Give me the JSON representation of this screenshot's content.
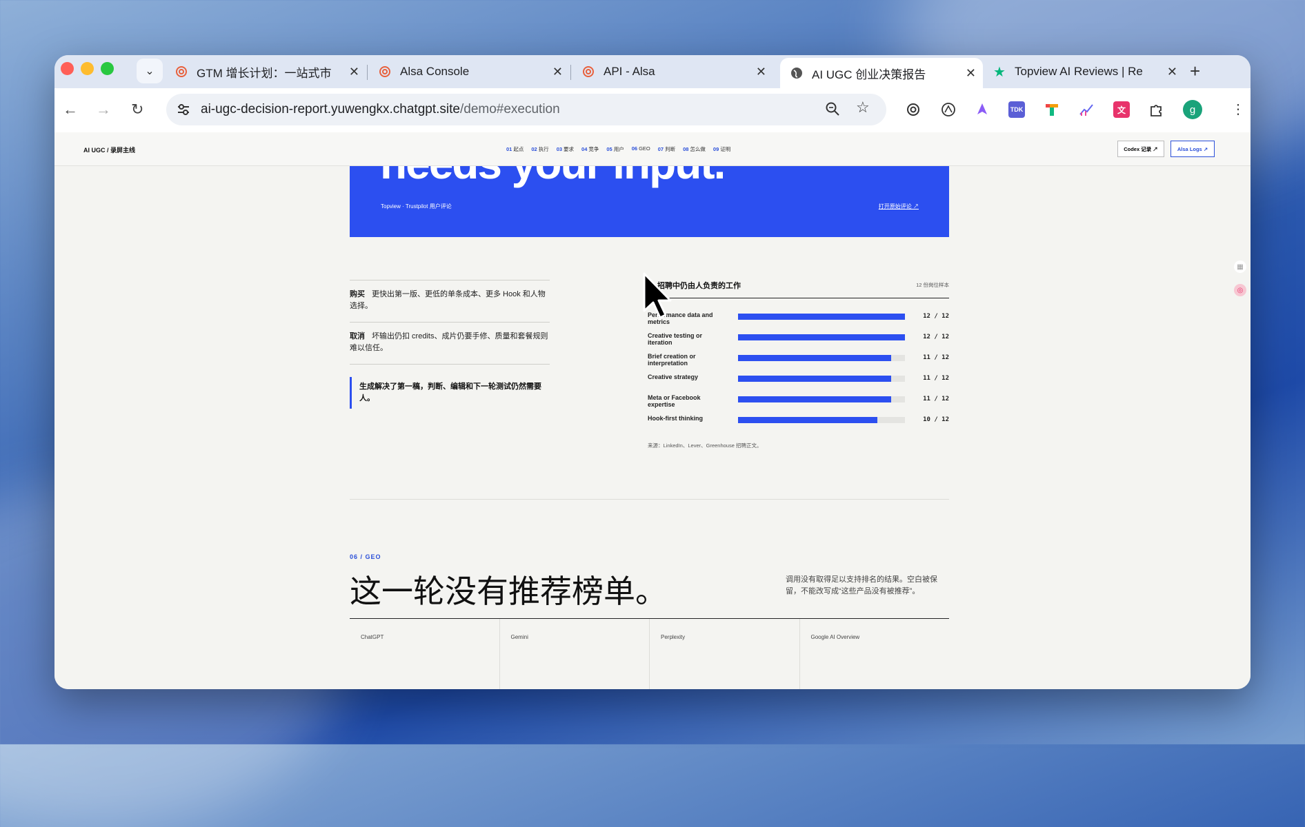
{
  "browser": {
    "tabs": [
      {
        "label": "GTM 增长计划：一站式市",
        "icon": "openai-icon",
        "active": false
      },
      {
        "label": "Alsa Console",
        "icon": "openai-icon",
        "active": false
      },
      {
        "label": "API - Alsa",
        "icon": "openai-icon",
        "active": false
      },
      {
        "label": "AI UGC 创业决策报告",
        "icon": "globe-icon",
        "active": true
      },
      {
        "label": "Topview AI Reviews | Re",
        "icon": "trustpilot-star-icon",
        "active": false
      }
    ],
    "url_host": "ai-ugc-decision-report.yuwengkx.chatgpt.site",
    "url_path": "/demo#execution",
    "profile_initial": "g",
    "extension_tdk": "TDK"
  },
  "site": {
    "brand": "AI UGC / 录屏主线",
    "nav": [
      {
        "num": "01",
        "label": "起点"
      },
      {
        "num": "02",
        "label": "执行"
      },
      {
        "num": "03",
        "label": "要求"
      },
      {
        "num": "04",
        "label": "竞争"
      },
      {
        "num": "05",
        "label": "用户"
      },
      {
        "num": "06",
        "label": "GEO"
      },
      {
        "num": "07",
        "label": "判断"
      },
      {
        "num": "08",
        "label": "怎么做"
      },
      {
        "num": "09",
        "label": "证明"
      }
    ],
    "codex_button": "Codex 记录 ↗",
    "alsa_button": "Alsa Logs ↗"
  },
  "banner": {
    "big_text": "needs your input.",
    "source": "Topview · Trustpilot 用户评论",
    "link": "打开原始评论 ↗"
  },
  "left": {
    "rows": [
      {
        "key": "购买",
        "text": "更快出第一版、更低的单条成本、更多 Hook 和人物选择。"
      },
      {
        "key": "取消",
        "text": "坏输出仍扣 credits、成片仍要手修、质量和套餐规则难以信任。"
      }
    ],
    "quote": "生成解决了第一稿，判断、编辑和下一轮测试仍然需要人。"
  },
  "chart_data": {
    "type": "bar",
    "title": "招聘中仍由人负责的工作",
    "note": "12 份岗位样本",
    "categories": [
      "Performance data and metrics",
      "Creative testing or iteration",
      "Brief creation or interpretation",
      "Creative strategy",
      "Meta or Facebook expertise",
      "Hook-first thinking"
    ],
    "values": [
      12,
      12,
      11,
      11,
      11,
      10
    ],
    "max": 12,
    "value_labels": [
      "12 / 12",
      "12 / 12",
      "11 / 12",
      "11 / 12",
      "11 / 12",
      "10 / 12"
    ],
    "source": "来源：LinkedIn、Lever、Greenhouse 招聘正文。",
    "color": "#2c4ff0"
  },
  "section": {
    "label": "06 / GEO",
    "title": "这一轮没有推荐榜单。",
    "description": "调用没有取得足以支持排名的结果。空白被保留，不能改写成“这些产品没有被推荐”。",
    "engines": [
      "ChatGPT",
      "Gemini",
      "Perplexity",
      "Google AI Overview"
    ]
  }
}
